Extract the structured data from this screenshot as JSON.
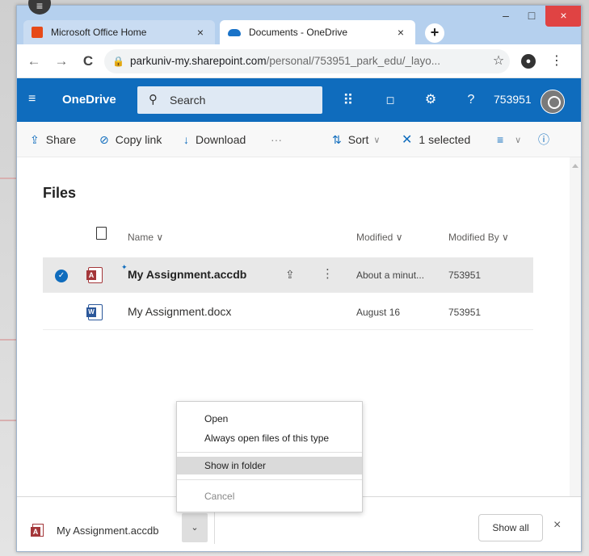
{
  "browser": {
    "tabs": [
      {
        "label": "Microsoft Office Home",
        "close": "×"
      },
      {
        "label": "Documents - OneDrive",
        "close": "×"
      }
    ],
    "new_tab": "+",
    "window_controls": {
      "minimize": "–",
      "maximize": "□",
      "close": "×"
    },
    "nav": {
      "back": "←",
      "forward": "→",
      "reload": "C"
    },
    "url": {
      "host": "parkuniv-my.sharepoint.com",
      "path": "/personal/753951_park_edu/_layo..."
    },
    "star": "☆",
    "kebab": "⋮"
  },
  "onedrive": {
    "brand": "OneDrive",
    "search_placeholder": "Search",
    "user_id": "753951",
    "icons": {
      "waffle": "⠿",
      "bell": "🔔",
      "settings": "⚙",
      "help": "?"
    }
  },
  "commands": {
    "share": "Share",
    "copy_link": "Copy link",
    "download": "Download",
    "more": "···",
    "sort": "Sort",
    "selected": "1 selected",
    "info": "ⓘ"
  },
  "files": {
    "title": "Files",
    "columns": {
      "name": "Name",
      "modified": "Modified",
      "modified_by": "Modified By"
    },
    "rows": [
      {
        "name": "My Assignment.accdb",
        "modified": "About a minut...",
        "modified_by": "753951",
        "selected": true,
        "type": "access"
      },
      {
        "name": "My Assignment.docx",
        "modified": "August 16",
        "modified_by": "753951",
        "selected": false,
        "type": "word"
      }
    ]
  },
  "context_menu": {
    "items": [
      "Open",
      "Always open files of this type",
      "Show in folder",
      "Cancel"
    ],
    "highlighted": "Show in folder",
    "disabled": "Cancel"
  },
  "download_shelf": {
    "file_name": "My Assignment.accdb",
    "chevron": "⌄",
    "show_all": "Show all",
    "close": "×"
  }
}
